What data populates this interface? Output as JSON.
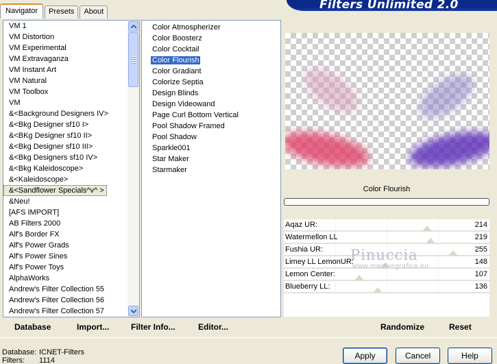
{
  "tabs": [
    "Navigator",
    "Presets",
    "About"
  ],
  "banner_title": "Filters Unlimited 2.0",
  "categories": [
    "VM 1",
    "VM Distortion",
    "VM Experimental",
    "VM Extravaganza",
    "VM Instant Art",
    "VM Natural",
    "VM Toolbox",
    "VM",
    "&<Background Designers IV>",
    "&<Bkg Designer sf10 I>",
    "&<BKg Designer sf10 II>",
    "&<Bkg Designer sf10 III>",
    "&<Bkg Designers sf10 IV>",
    "&<Bkg Kaleidoscope>",
    "&<Kaleidoscope>",
    "&<Sandflower Specials^v^ >",
    "&Neu!",
    "[AFS IMPORT]",
    "AB Filters 2000",
    "Alf's Border FX",
    "Alf's Power Grads",
    "Alf's Power Sines",
    "Alf's Power Toys",
    "AlphaWorks",
    "Andrew's Filter Collection 55",
    "Andrew's Filter Collection 56",
    "Andrew's Filter Collection 57"
  ],
  "selected_category": "&<Sandflower Specials^v^ >",
  "filters": [
    "Color Atmospherizer",
    "Color Boosterz",
    "Color Cocktail",
    "Color Flourish",
    "Color Gradiant",
    "Colorize Septia",
    "Design Blinds",
    "Design Videowand",
    "Page Curl Bottom Vertical",
    "Pool Shadow Framed",
    "Pool Shadow",
    "Sparkle001",
    "Star Maker",
    "Starmaker"
  ],
  "selected_filter": "Color Flourish",
  "current_filter_name": "Color Flourish",
  "sliders": [
    {
      "label": "Aqaz UR:",
      "value": "214",
      "level": 214
    },
    {
      "label": "Watermellon LL",
      "value": "219",
      "level": 219
    },
    {
      "label": "Fushia UR:",
      "value": "255",
      "level": 255
    },
    {
      "label": "Limey LL LemonUR:",
      "value": "148",
      "level": 148
    },
    {
      "label": "Lemon Center:",
      "value": "107",
      "level": 107
    },
    {
      "label": "Blueberry LL:",
      "value": "136",
      "level": 136
    }
  ],
  "watermark": {
    "name": "Pinuccia",
    "site": "www.maidiregrafica.eu"
  },
  "buttons": {
    "database": "Database",
    "import": "Import...",
    "filter_info": "Filter Info...",
    "editor": "Editor...",
    "randomize": "Randomize",
    "reset": "Reset",
    "apply": "Apply",
    "cancel": "Cancel",
    "help": "Help"
  },
  "status": {
    "database_label": "Database:",
    "database_value": "ICNET-Filters",
    "filters_label": "Filters:",
    "filters_value": "1114"
  },
  "colors": {
    "selection": "#316ac5",
    "banner": "#0a2a8a",
    "active_tab_accent": "#e68b2c"
  }
}
